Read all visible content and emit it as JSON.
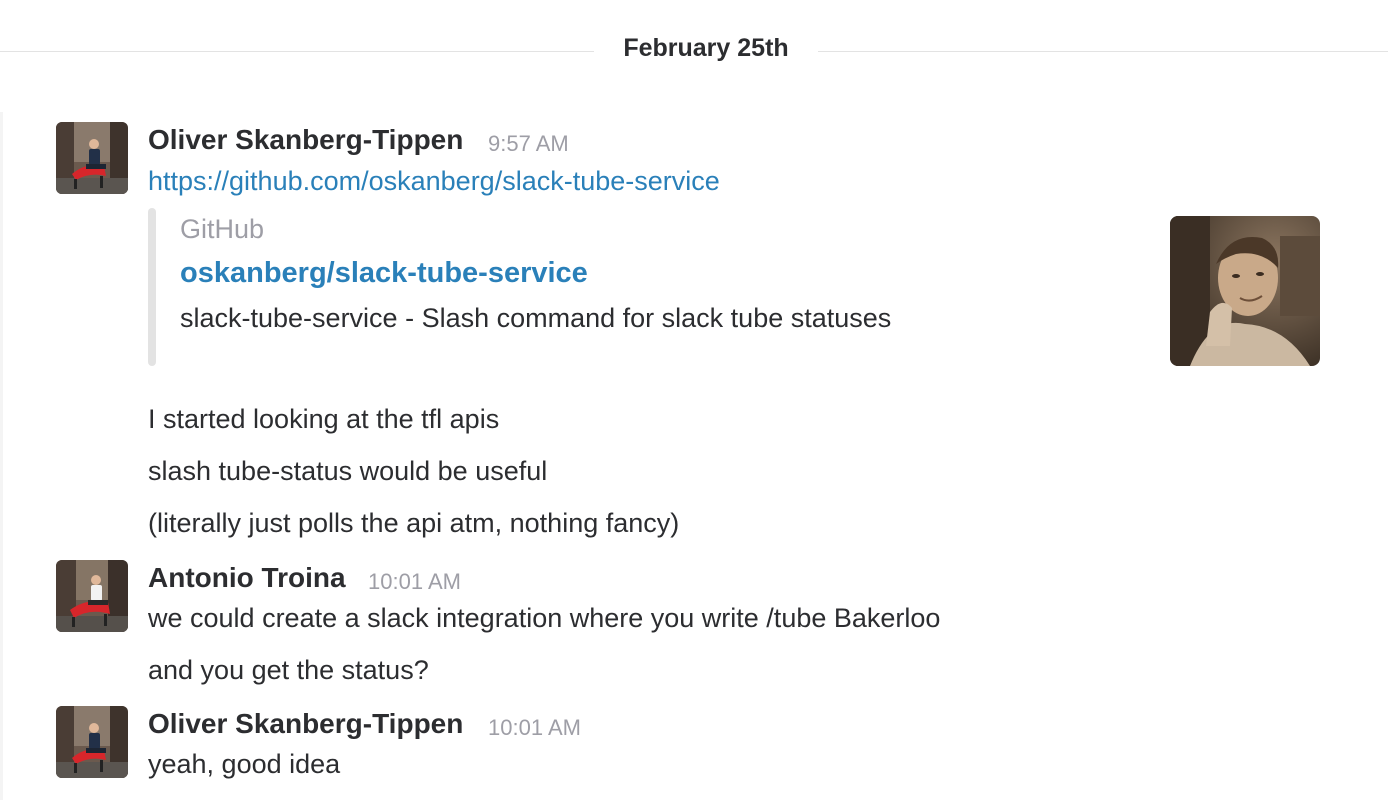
{
  "divider": {
    "date": "February 25th"
  },
  "messages": [
    {
      "sender": "Oliver Skanberg-Tippen",
      "time": "9:57 AM",
      "link": "https://github.com/oskanberg/slack-tube-service",
      "attachment": {
        "service": "GitHub",
        "title": "oskanberg/slack-tube-service",
        "description": "slack-tube-service - Slash command for slack tube statuses"
      },
      "lines": [
        "I started looking at the tfl apis",
        "slash tube-status would be useful",
        "(literally just polls the api atm, nothing fancy)"
      ]
    },
    {
      "sender": "Antonio Troina",
      "time": "10:01 AM",
      "lines": [
        "we could create a slack integration where you write /tube Bakerloo",
        "and you get the status?"
      ]
    },
    {
      "sender": "Oliver Skanberg-Tippen",
      "time": "10:01 AM",
      "lines": [
        "yeah, good idea"
      ]
    }
  ],
  "colors": {
    "link": "#2a80b9",
    "timestamp": "#9e9ea6",
    "text": "#2c2d30",
    "divider": "#e3e3e3",
    "avatar_chair": "#d7262b"
  }
}
